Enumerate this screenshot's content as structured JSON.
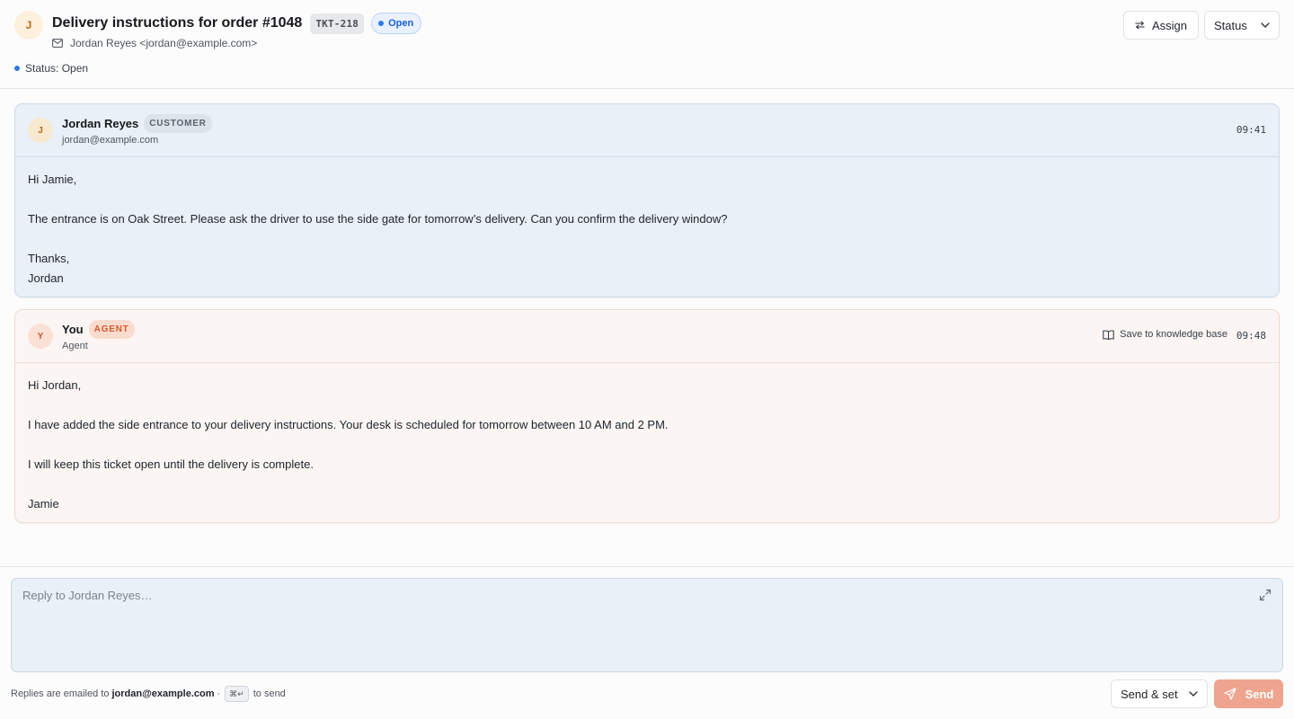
{
  "ticket": {
    "avatar_initial": "J",
    "title": "Delivery instructions for order #1048",
    "id": "TKT-218",
    "status_pill": "Open",
    "from": "Jordan Reyes <jordan@example.com>",
    "status_line": "Status: Open"
  },
  "toolbar": {
    "assign_label": "Assign",
    "status_label": "Status"
  },
  "messages": [
    {
      "avatar_initial": "J",
      "name": "Jordan Reyes",
      "role": "CUSTOMER",
      "sub": "jordan@example.com",
      "time": "09:41",
      "body": [
        "Hi Jamie,",
        "The entrance is on Oak Street. Please ask the driver to use the side gate for tomorrow’s delivery. Can you confirm the delivery window?",
        "Thanks,",
        "Jordan"
      ]
    },
    {
      "avatar_initial": "Y",
      "name": "You",
      "role": "AGENT",
      "sub": "Agent",
      "time": "09:48",
      "kb_label": "Save to knowledge base",
      "body": [
        "Hi Jordan,",
        "I have added the side entrance to your delivery instructions. Your desk is scheduled for tomorrow between 10 AM and 2 PM.",
        "I will keep this ticket open until the delivery is complete.",
        "Jamie"
      ]
    }
  ],
  "composer": {
    "placeholder": "Reply to Jordan Reyes…",
    "value": "",
    "note_prefix": "Replies are emailed to",
    "note_email": "jordan@example.com",
    "note_sep": "·",
    "shortcut": "⌘↵",
    "note_suffix": "to send",
    "send_set_label": "Send & set",
    "send_label": "Send"
  },
  "colors": {
    "accent_blue": "#2f78ea",
    "customer_bg": "#e9f0f7",
    "agent_bg": "#fbf6f4",
    "send_button": "#eea48e"
  }
}
